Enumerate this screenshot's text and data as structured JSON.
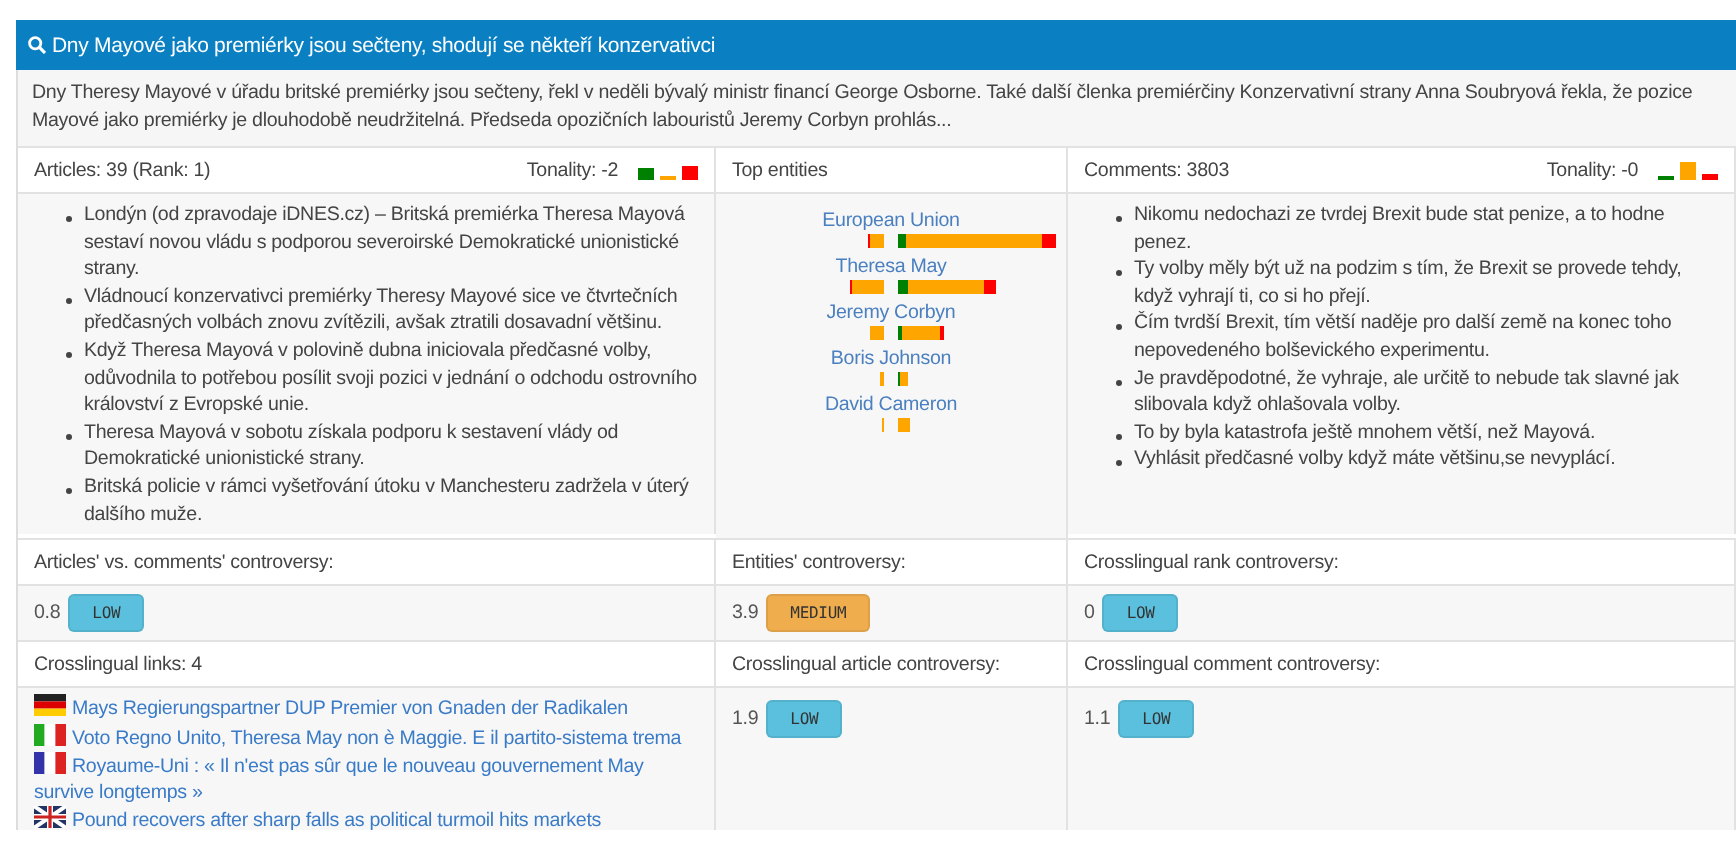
{
  "header": {
    "title": "Dny Mayové jako premiérky jsou sečteny, shodují se někteří konzervativci"
  },
  "summary": "Dny Theresy Mayové v úřadu britské premiérky jsou sečteny, řekl v neděli bývalý ministr financí George Osborne. Také další členka premiérčiny Konzervativní strany Anna Soubryová řekla, že pozice Mayové jako premiérky je dlouhodobě neudržitelná. Předseda opozičních labouristů Jeremy Corbyn prohlás...",
  "articles": {
    "heading": "Articles: 39 (Rank: 1)",
    "tonality_label": "Tonality: -2",
    "tonality_bars": [
      {
        "color": "#008000"
      },
      {
        "color": "#ffa500"
      },
      {
        "color": "#ff0000"
      }
    ],
    "items": [
      "Londýn (od zpravodaje iDNES.cz) – Britská premiérka Theresa Mayová sestaví novou vládu s podporou severoirské Demokratické unionistické strany.",
      "Vládnoucí konzervativci premiérky Theresy Mayové sice ve čtvrtečních předčasných volbách znovu zvítězili, avšak ztratili dosavadní většinu.",
      "Když Theresa Mayová v polovině dubna iniciovala předčasné volby, odůvodnila to potřebou posílit svoji pozici v jednání o odchodu ostrovního království z Evropské unie.",
      "Theresa Mayová v sobotu získala podporu k sestavení vlády od Demokratické unionistické strany.",
      "Britská policie v rámci vyšetřování útoku v Manchesteru zadržela v úterý dalšího muže."
    ]
  },
  "entities": {
    "heading": "Top entities",
    "items": [
      {
        "name": "European Union",
        "left": [
          {
            "color": "#ff0000"
          },
          {
            "color": "#ffa500"
          }
        ],
        "right": [
          {
            "color": "#008000"
          },
          {
            "color": "#ffa500"
          },
          {
            "color": "#ff0000"
          }
        ]
      },
      {
        "name": "Theresa May",
        "left": [
          {
            "color": "#ff0000"
          },
          {
            "color": "#ffa500"
          }
        ],
        "right": [
          {
            "color": "#008000"
          },
          {
            "color": "#ffa500"
          },
          {
            "color": "#ff0000"
          }
        ]
      },
      {
        "name": "Jeremy Corbyn",
        "left": [
          {
            "color": "#ffa500"
          }
        ],
        "right": [
          {
            "color": "#008000"
          },
          {
            "color": "#ffa500"
          },
          {
            "color": "#ff0000"
          }
        ]
      },
      {
        "name": "Boris Johnson",
        "left": [
          {
            "color": "#ffa500"
          }
        ],
        "right": [
          {
            "color": "#008000"
          },
          {
            "color": "#ffa500"
          }
        ]
      },
      {
        "name": "David Cameron",
        "left": [
          {
            "color": "#ffa500"
          }
        ],
        "right": [
          {
            "color": "#ffa500"
          }
        ]
      }
    ]
  },
  "comments": {
    "heading": "Comments: 3803",
    "tonality_label": "Tonality: -0",
    "tonality_bars": [
      {
        "color": "#008000"
      },
      {
        "color": "#ffa500"
      },
      {
        "color": "#ff0000"
      }
    ],
    "items": [
      "Nikomu nedochazi ze tvrdej Brexit bude stat penize, a to hodne penez.",
      "Ty volby měly být už na podzim s tím, že Brexit se provede tehdy, když vyhrají ti, co si ho přejí.",
      "Čím tvrdší Brexit, tím větší naděje pro další země na konec toho nepovedeného bolševického experimentu.",
      "Je pravděpodotné, že vyhraje, ale určitě to nebude tak slavné jak slibovala když ohlašovala volby.",
      "To by byla katastrofa ještě mnohem větší, než Mayová.",
      "Vyhlásit předčasné volby když máte většinu,se nevyplácí."
    ]
  },
  "controversy": [
    {
      "label": "Articles' vs. comments' controversy:",
      "value": "0.8",
      "badge": "LOW",
      "color": "#5bc0de"
    },
    {
      "label": "Entities' controversy:",
      "value": "3.9",
      "badge": "MEDIUM",
      "color": "#f0ad4e"
    },
    {
      "label": "Crosslingual rank controversy:",
      "value": "0",
      "badge": "LOW",
      "color": "#5bc0de"
    }
  ],
  "crosslingual": {
    "heading": "Crosslingual links: 4",
    "links": [
      {
        "kind": "de",
        "text": "Mays Regierungspartner DUP Premier von Gnaden der Radikalen"
      },
      {
        "kind": "it",
        "text": "Voto Regno Unito, Theresa May non è Maggie. E il partito-sistema trema"
      },
      {
        "kind": "fr",
        "text": "Royaume-Uni : « Il n'est pas sûr que le nouveau gouvernement May survive longtemps »"
      },
      {
        "kind": "gb",
        "text": "Pound recovers after sharp falls as political turmoil hits markets"
      }
    ],
    "metrics": [
      {
        "label": "Crosslingual article controversy:",
        "value": "1.9",
        "badge": "LOW",
        "color": "#5bc0de"
      },
      {
        "label": "Crosslingual comment controversy:",
        "value": "1.1",
        "badge": "LOW",
        "color": "#5bc0de"
      }
    ]
  }
}
